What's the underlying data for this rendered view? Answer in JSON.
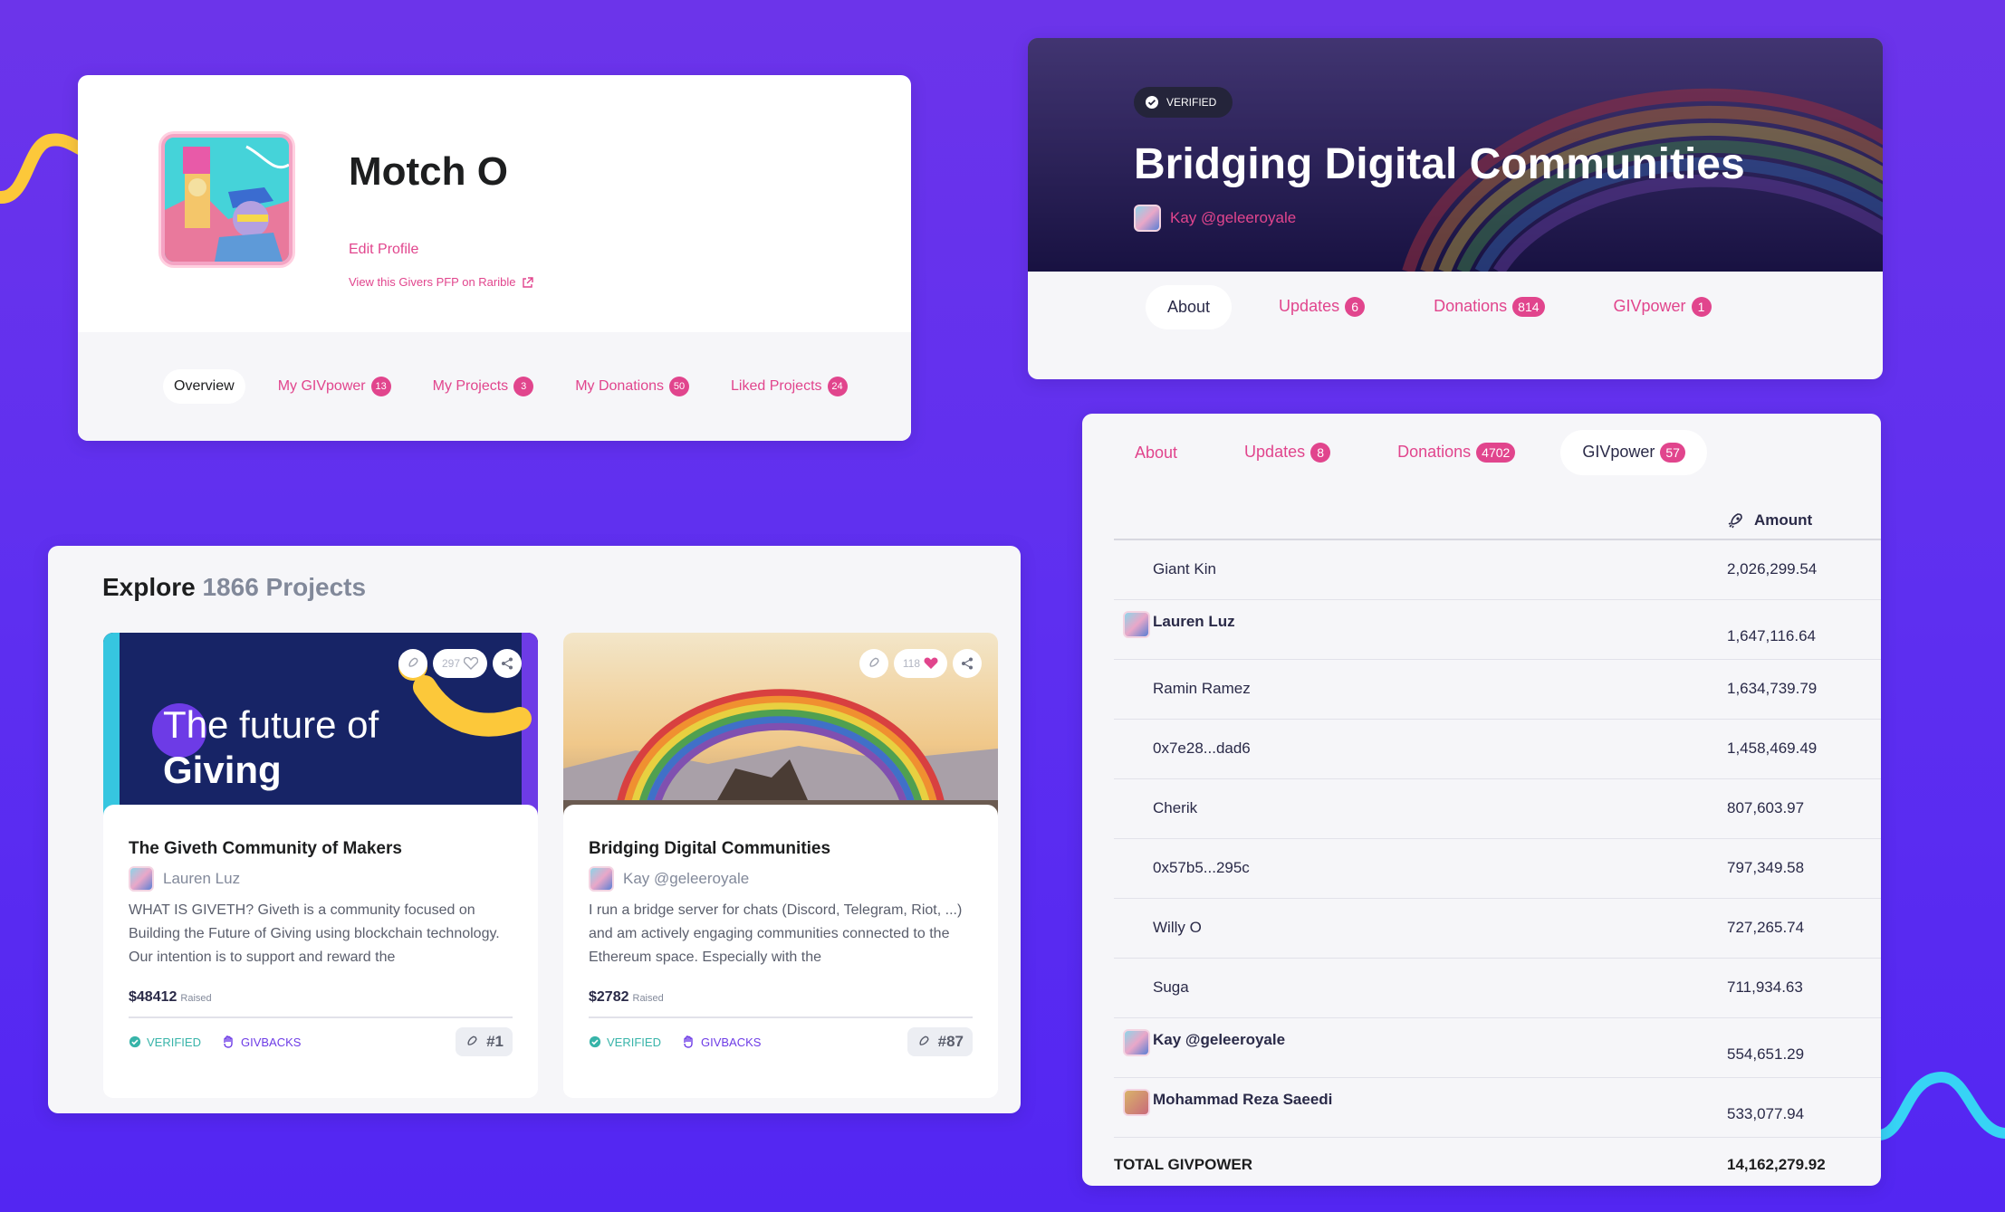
{
  "profile": {
    "name": "Motch O",
    "edit_label": "Edit Profile",
    "view_pfp_label": "View this Givers PFP on Rarible",
    "tabs": [
      {
        "label": "Overview",
        "count": ""
      },
      {
        "label": "My GIVpower",
        "count": "13"
      },
      {
        "label": "My Projects",
        "count": "3"
      },
      {
        "label": "My Donations",
        "count": "50"
      },
      {
        "label": "Liked Projects",
        "count": "24"
      }
    ]
  },
  "project_header": {
    "verified_label": "VERIFIED",
    "title": "Bridging Digital Communities",
    "author": "Kay @geleeroyale",
    "tabs": [
      {
        "label": "About",
        "count": ""
      },
      {
        "label": "Updates",
        "count": "6"
      },
      {
        "label": "Donations",
        "count": "814"
      },
      {
        "label": "GIVpower",
        "count": "1"
      }
    ]
  },
  "givpower": {
    "tabs": [
      {
        "label": "About",
        "count": ""
      },
      {
        "label": "Updates",
        "count": "8"
      },
      {
        "label": "Donations",
        "count": "4702"
      },
      {
        "label": "GIVpower",
        "count": "57"
      }
    ],
    "amount_header": "Amount",
    "rows": [
      {
        "name": "Giant Kin",
        "amount": "2,026,299.54",
        "avatar": false
      },
      {
        "name": "Lauren Luz",
        "amount": "1,647,116.64",
        "avatar": true
      },
      {
        "name": "Ramin Ramez",
        "amount": "1,634,739.79",
        "avatar": false
      },
      {
        "name": "0x7e28...dad6",
        "amount": "1,458,469.49",
        "avatar": false
      },
      {
        "name": "Cherik",
        "amount": "807,603.97",
        "avatar": false
      },
      {
        "name": "0x57b5...295c",
        "amount": "797,349.58",
        "avatar": false
      },
      {
        "name": "Willy O",
        "amount": "727,265.74",
        "avatar": false
      },
      {
        "name": "Suga",
        "amount": "711,934.63",
        "avatar": false
      },
      {
        "name": "Kay @geleeroyale",
        "amount": "554,651.29",
        "avatar": true
      },
      {
        "name": "Mohammad Reza Saeedi",
        "amount": "533,077.94",
        "avatar": true
      }
    ],
    "total_label": "TOTAL GIVPOWER",
    "total_value": "14,162,279.92"
  },
  "explore": {
    "title": "Explore",
    "count_label": "1866 Projects",
    "cards": [
      {
        "image_text_1": "The future of",
        "image_text_2": "Giving",
        "likes": "297",
        "title": "The Giveth Community of Makers",
        "author": "Lauren Luz",
        "description": "WHAT IS GIVETH? Giveth is a community focused on Building the Future of Giving using blockchain technology. Our intention is to support and reward the",
        "raised": "$48412",
        "raised_label": "Raised",
        "verified": "VERIFIED",
        "givbacks": "GIVBACKS",
        "rank": "#1"
      },
      {
        "likes": "118",
        "title": "Bridging Digital Communities",
        "author": "Kay @geleeroyale",
        "description": "I run a bridge server for chats (Discord, Telegram, Riot, ...) and am actively engaging communities connected to the Ethereum space. Especially with the",
        "raised": "$2782",
        "raised_label": "Raised",
        "verified": "VERIFIED",
        "givbacks": "GIVBACKS",
        "rank": "#87"
      }
    ]
  },
  "colors": {
    "background": "#5e2ff0",
    "accent_pink": "#e1458d",
    "verified_teal": "#37b4a9",
    "givbacks_purple": "#6d3be6"
  }
}
